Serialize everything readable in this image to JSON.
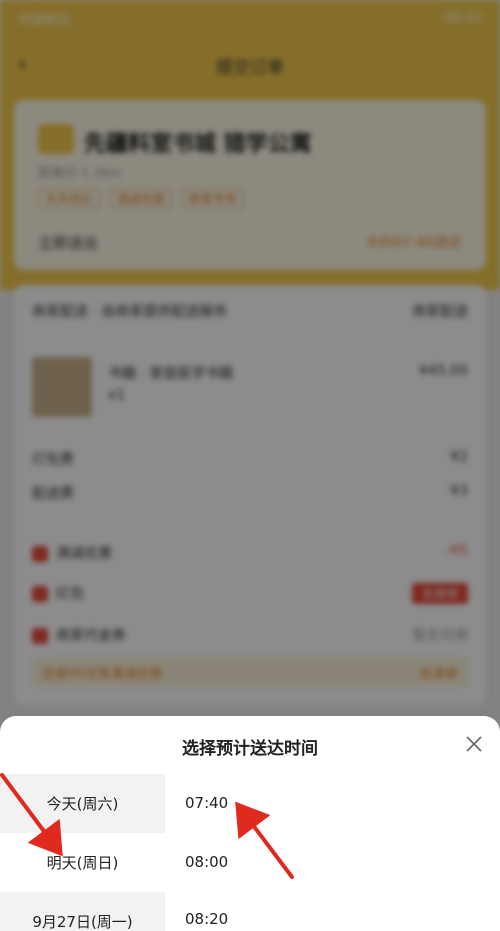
{
  "status_bar": {
    "carrier": "中国移动",
    "time": "08:33"
  },
  "nav": {
    "title": "提交订单"
  },
  "shop": {
    "name": "先疆料室书城 猎学公寓",
    "sub": "距离约 1.2km",
    "tags": [
      "天天低价",
      "满减优惠",
      "新客专享"
    ],
    "delivery_label": "立即送出",
    "delivery_value": "大约07:40送达"
  },
  "order": {
    "header": "商家配送 · 由商家提供配送服务",
    "header_right": "商家配送",
    "item_name": "书籍 · 家庭医学书籍",
    "item_price": "¥45.00",
    "item_qty": "x1",
    "row_package": "打包费",
    "row_package_value": "¥2",
    "row_delivery": "配送费",
    "row_delivery_value": "¥3",
    "row_red1": "满减优惠",
    "row_red1_value": "-¥5",
    "row_red2": "红包",
    "row_red2_btn": "去使用",
    "row_red3": "商家代金券",
    "row_red3_value": "暂无可用",
    "coupon_text": "还差¥5可享满减优惠",
    "coupon_right": "去凑单"
  },
  "sheet": {
    "title": "选择预计送达时间",
    "close_icon": "close-icon",
    "days": [
      {
        "label": "今天(周六)",
        "style": "gray"
      },
      {
        "label": "明天(周日)",
        "style": "white"
      },
      {
        "label": "9月27日(周一)",
        "style": "gray"
      }
    ],
    "times": [
      "07:40",
      "08:00",
      "08:20"
    ]
  },
  "annotations": {
    "arrow_color": "#e02a20"
  }
}
